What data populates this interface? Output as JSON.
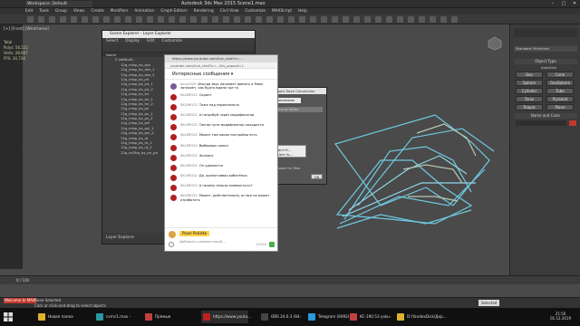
{
  "titlebar": {
    "workspace": "Workspace: Default",
    "title": "Autodesk 3ds Max 2015    Scene1.max",
    "controls": [
      "–",
      "□",
      "✕"
    ]
  },
  "menubar": [
    "Edit",
    "Tools",
    "Group",
    "Views",
    "Create",
    "Modifiers",
    "Animation",
    "Graph Editors",
    "Rendering",
    "Civil View",
    "Customize",
    "MAXScript",
    "Help"
  ],
  "viewport": {
    "label": "[+] [Front] [Wireframe]",
    "stats": [
      "Total",
      "Polys: 56,522",
      "Verts: 28,907",
      "FPS: 34,734"
    ]
  },
  "command_panel": {
    "dropdown": "Standard Primitives",
    "section_object_type": "Object Type",
    "autogrid": "AutoGrid",
    "buttons": [
      "Box",
      "Cone",
      "Sphere",
      "GeoSphere",
      "Cylinder",
      "Tube",
      "Torus",
      "Pyramid",
      "Teapot",
      "Plane"
    ],
    "section_name_color": "Name and Color"
  },
  "scene_explorer": {
    "title": "Scene Explorer - Layer Explorer",
    "menu": [
      "Select",
      "Display",
      "Edit",
      "Customize"
    ],
    "column_header": "Name",
    "items": [
      "0 (default)",
      "12g_mlsp_bs_dzn",
      "12g_mlsp_bs_dzn_1",
      "12g_mlsp_bs_dzn_2",
      "12g_mlsp_bs_jnt",
      "12g_mlsp_bs_jnt_1",
      "12g_mlsp_bs_jnt_2",
      "12g_mlsp_bs_lnr",
      "12g_mlsp_bs_lnr_1",
      "12g_mlsp_bs_lnr_2",
      "12g_mlsp_bs_pn",
      "12g_mlsp_bs_pn_1",
      "12g_mlsp_bs_pn_2",
      "12g_mlsp_bs_pnl",
      "12g_mlsp_bs_pnl_1",
      "12g_mlsp_bs_pnl_2",
      "12g_mlsp_bs_rd",
      "12g_mlsp_bs_rd_1",
      "12g_mlsp_bs_rd_2",
      "12g_ml3bp_bs_pn_jnt"
    ],
    "footer": "Layer Explorer"
  },
  "youtube_chat": {
    "window_title": "https://www.youtube.com/live_chat?v=...",
    "url": "youtube.com/live_chat?v=...&is_popout=1",
    "header": "Интересные сообщения ▾",
    "messages": [
      {
        "user": "Ivnick329",
        "text": "Иногда звук начинает фонить и Potoc затихает, как будто вдали где то"
      },
      {
        "user": "SKLERO22",
        "text": "Скрипт"
      },
      {
        "user": "SKLERO22",
        "text": "Тоже над параллельно"
      },
      {
        "user": "SKLERO22",
        "text": "А потробуй через модификатор"
      },
      {
        "user": "SKLERO22",
        "text": "Там во пути модификатор находится"
      },
      {
        "user": "SKLERO22",
        "text": "Может там какие настройки есть"
      },
      {
        "user": "SKLERO22",
        "text": "Выберешь канал"
      },
      {
        "user": "SKLERO22",
        "text": "Холлапс"
      },
      {
        "user": "SKLERO22",
        "text": "Он удаляется"
      },
      {
        "user": "SKLERO22",
        "text": "Да, кропотливая работёнка"
      },
      {
        "user": "SKLERO22",
        "text": "А почему нельзя конвертнуть?"
      },
      {
        "user": "SKLERO22",
        "text": "Может, действительно, он все не может отработать"
      }
    ],
    "author": "Pavel Pokidko",
    "placeholder": "Добавить комментарий...",
    "counter": "0/200"
  },
  "dialog": {
    "title": "Export Save Conversion",
    "tab": "Conversion",
    "field": "Format folder",
    "mini_title": "Batch fi...",
    "mini_text": "Select fo...",
    "ok": "OK",
    "answer_label": "Answer for files"
  },
  "timeline": {
    "frame": "0 / 100"
  },
  "statusbar": {
    "selection": "None Selected",
    "hint": "Click or click-and-drag to select objects",
    "welcome": "Welcome to MAX",
    "mode": "Selected"
  },
  "taskbar": {
    "tasks": [
      "Новая папка",
      "cvmc1.max - Auto...",
      "Прямые трансля...",
      "https://www.youtu...",
      "OBS 24.0.3 (64-bit,...",
      "Telegram (6092)",
      "KC-190.53 yoku-ic...",
      "D:\\YandexDisk\\Дер..."
    ],
    "time": "21:50",
    "date": "01.12.2019"
  },
  "colors": {
    "wire": "#6ec9e0",
    "wire_alt": "#b8c8b0"
  }
}
